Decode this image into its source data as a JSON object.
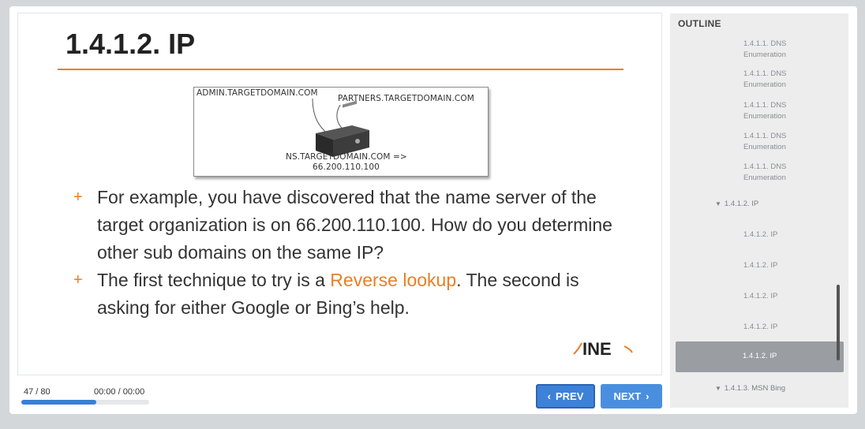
{
  "slide": {
    "title": "1.4.1.2. IP",
    "diagram": {
      "label_admin": "ADMIN.TARGETDOMAIN.COM",
      "label_partners": "PARTNERS.TARGETDOMAIN.COM",
      "label_ns": "NS.TARGETDOMAIN.COM =>",
      "label_ip": "66.200.110.100"
    },
    "bullets": [
      {
        "text": "For example, you have discovered that the name server of the target organization is on 66.200.110.100. How do you determine other sub domains on the same IP?"
      },
      {
        "text_before": "The first technique to try is a ",
        "highlight": "Reverse lookup",
        "text_after": ". The second is asking for either Google or Bing’s help."
      }
    ],
    "bullet_marker": "+",
    "logo": "INE"
  },
  "player": {
    "counter": "47 / 80",
    "time": "00:00 / 00:00",
    "progress": 0.5875,
    "prev_label": "PREV",
    "next_label": "NEXT"
  },
  "outline": {
    "header": "OUTLINE",
    "items": [
      {
        "label": "1.4.1.1. DNS Enumeration",
        "type": "leaf"
      },
      {
        "label": "1.4.1.1. DNS Enumeration",
        "type": "leaf"
      },
      {
        "label": "1.4.1.1. DNS Enumeration",
        "type": "leaf"
      },
      {
        "label": "1.4.1.1. DNS Enumeration",
        "type": "leaf"
      },
      {
        "label": "1.4.1.1. DNS Enumeration",
        "type": "leaf"
      },
      {
        "label": "1.4.1.2. IP",
        "type": "section"
      },
      {
        "label": "1.4.1.2. IP",
        "type": "leaf"
      },
      {
        "label": "1.4.1.2. IP",
        "type": "leaf"
      },
      {
        "label": "1.4.1.2. IP",
        "type": "leaf"
      },
      {
        "label": "1.4.1.2. IP",
        "type": "leaf"
      },
      {
        "label": "1.4.1.2. IP",
        "type": "selected"
      },
      {
        "label": "1.4.1.3. MSN Bing",
        "type": "section"
      }
    ]
  },
  "colors": {
    "accent_orange": "#e87f26",
    "button_blue": "#4a8fdf",
    "progress_blue": "#3a7fd5"
  }
}
